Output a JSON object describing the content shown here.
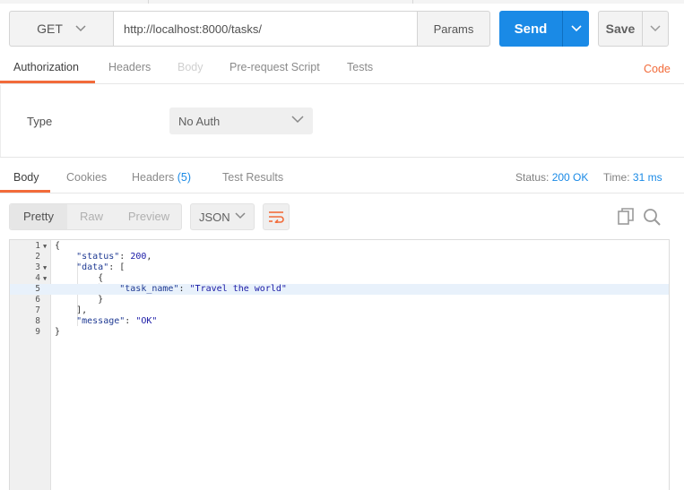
{
  "request": {
    "method": "GET",
    "url": "http://localhost:8000/tasks/",
    "params_label": "Params",
    "send_label": "Send",
    "save_label": "Save"
  },
  "request_tabs": {
    "authorization": "Authorization",
    "headers": "Headers",
    "body": "Body",
    "pre_request_script": "Pre-request Script",
    "tests": "Tests",
    "active": "Authorization"
  },
  "code_link": "Code",
  "auth": {
    "type_label": "Type",
    "type_value": "No Auth"
  },
  "response_tabs": {
    "body": "Body",
    "cookies": "Cookies",
    "headers": "Headers",
    "headers_count": "(5)",
    "test_results": "Test Results",
    "active": "Body"
  },
  "status": {
    "status_label": "Status:",
    "status_value": "200 OK",
    "time_label": "Time:",
    "time_value": "31 ms"
  },
  "view_modes": {
    "pretty": "Pretty",
    "raw": "Raw",
    "preview": "Preview",
    "active": "Pretty"
  },
  "format": "JSON",
  "code_lines": [
    {
      "n": "1",
      "fold": true,
      "text": "{"
    },
    {
      "n": "2",
      "fold": false,
      "text": "    \"status\": 200,"
    },
    {
      "n": "3",
      "fold": true,
      "text": "    \"data\": ["
    },
    {
      "n": "4",
      "fold": true,
      "text": "        {"
    },
    {
      "n": "5",
      "fold": false,
      "text": "            \"task_name\": \"Travel the world\""
    },
    {
      "n": "6",
      "fold": false,
      "text": "        }"
    },
    {
      "n": "7",
      "fold": false,
      "text": "    ],"
    },
    {
      "n": "8",
      "fold": false,
      "text": "    \"message\": \"OK\""
    },
    {
      "n": "9",
      "fold": false,
      "text": "}"
    }
  ],
  "highlighted_line": "5",
  "colors": {
    "accent_orange": "#f26b3a",
    "send_blue": "#1a8ae6"
  },
  "icons": [
    "chevron-down-icon",
    "copy-icon",
    "search-icon",
    "wrap-lines-icon",
    "fold-arrow-icon"
  ]
}
